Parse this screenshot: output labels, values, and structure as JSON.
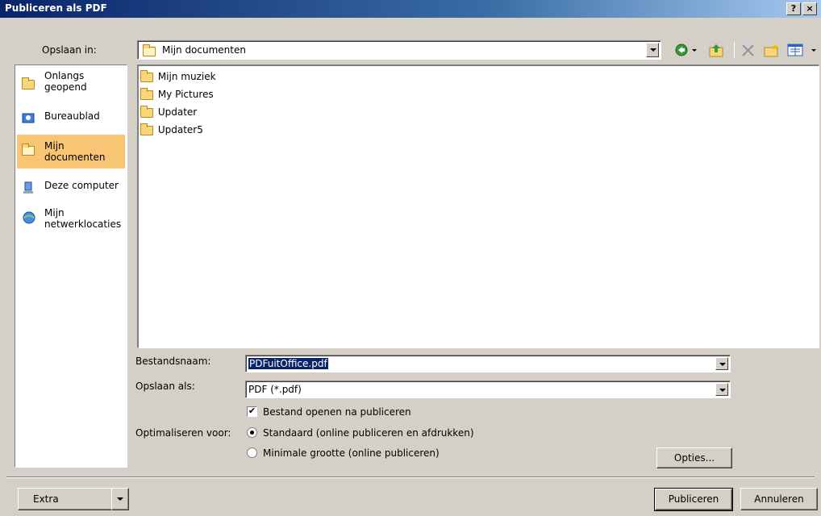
{
  "window": {
    "title": "Publiceren als PDF",
    "help_label": "?",
    "close_label": "×"
  },
  "toolbar": {
    "save_in_label": "Opslaan in:",
    "save_in_value": "Mijn documenten",
    "icons": [
      "back-icon",
      "up-folder-icon",
      "delete-icon",
      "new-folder-icon",
      "views-icon"
    ]
  },
  "places": [
    {
      "label": "Onlangs geopend",
      "icon": "recent-folder-icon",
      "selected": false
    },
    {
      "label": "Bureaublad",
      "icon": "desktop-icon",
      "selected": false
    },
    {
      "label": "Mijn documenten",
      "icon": "my-documents-icon",
      "selected": true
    },
    {
      "label": "Deze computer",
      "icon": "computer-icon",
      "selected": false
    },
    {
      "label": "Mijn netwerklocaties",
      "icon": "network-icon",
      "selected": false
    }
  ],
  "files": [
    {
      "name": "Mijn muziek"
    },
    {
      "name": "My Pictures"
    },
    {
      "name": "Updater"
    },
    {
      "name": "Updater5"
    }
  ],
  "form": {
    "filename_label": "Bestandsnaam:",
    "filename_value": "PDFuitOffice.pdf",
    "type_label": "Opslaan als:",
    "type_value": "PDF (*.pdf)",
    "open_after_label": "Bestand openen na publiceren",
    "open_after_checked": true,
    "optimize_label": "Optimaliseren voor:",
    "opt_standard_label": "Standaard (online publiceren en afdrukken)",
    "opt_minimal_label": "Minimale grootte (online publiceren)",
    "selected_option": "standard"
  },
  "buttons": {
    "options": "Opties...",
    "extra": "Extra",
    "publish": "Publiceren",
    "cancel": "Annuleren"
  }
}
